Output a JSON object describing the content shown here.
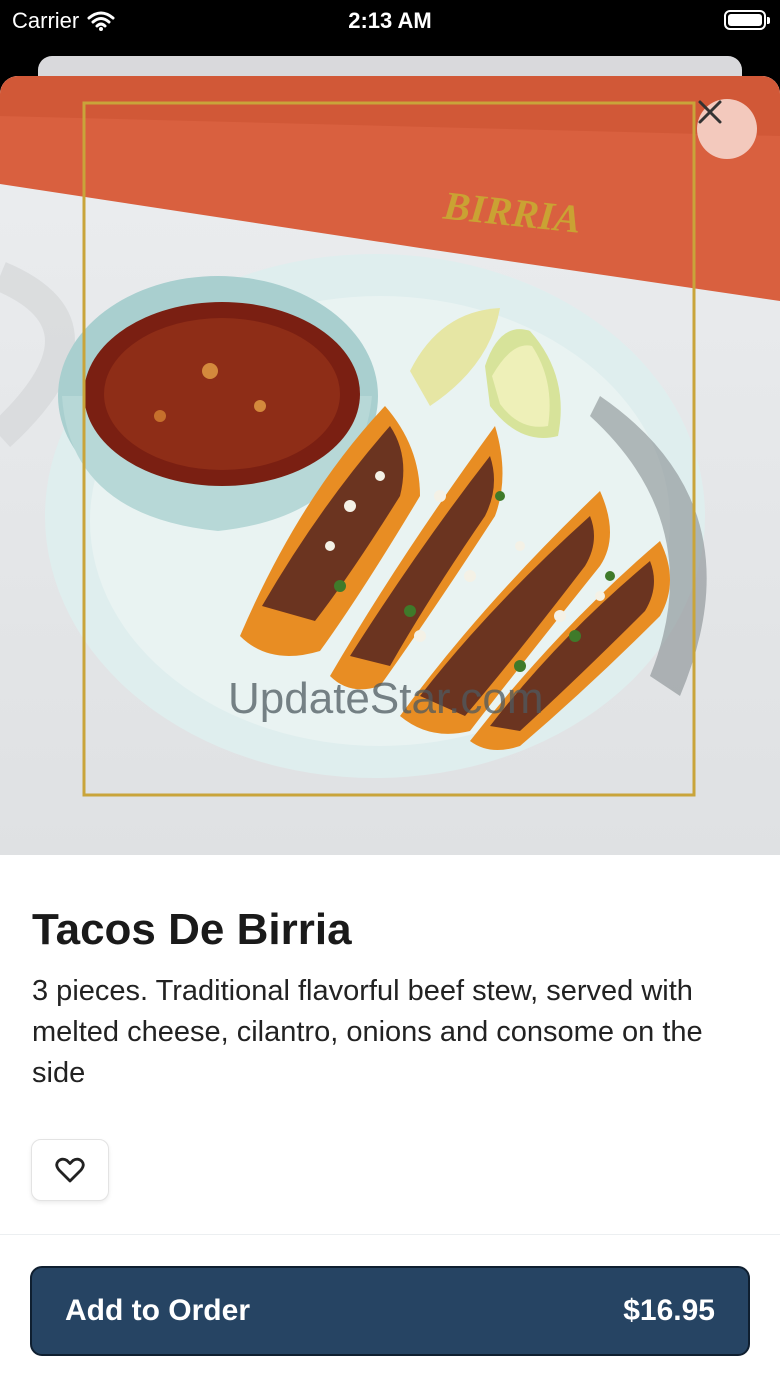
{
  "status_bar": {
    "carrier": "Carrier",
    "time": "2:13 AM"
  },
  "hero": {
    "banner_text": "BIRRIA",
    "watermark": "UpdateStar.com"
  },
  "item": {
    "title": "Tacos De Birria",
    "description": "3 pieces. Traditional flavorful beef stew, served with melted cheese, cilantro, onions and consome on the side"
  },
  "actions": {
    "add_label": "Add to Order",
    "price": "$16.95"
  },
  "colors": {
    "accent": "#264463",
    "banner": "#d9603f",
    "frame": "#c9a43a",
    "close_bg": "#f3c9bd"
  },
  "icons": {
    "close": "close-icon",
    "favorite": "heart-icon",
    "wifi": "wifi-icon",
    "battery": "battery-icon"
  }
}
